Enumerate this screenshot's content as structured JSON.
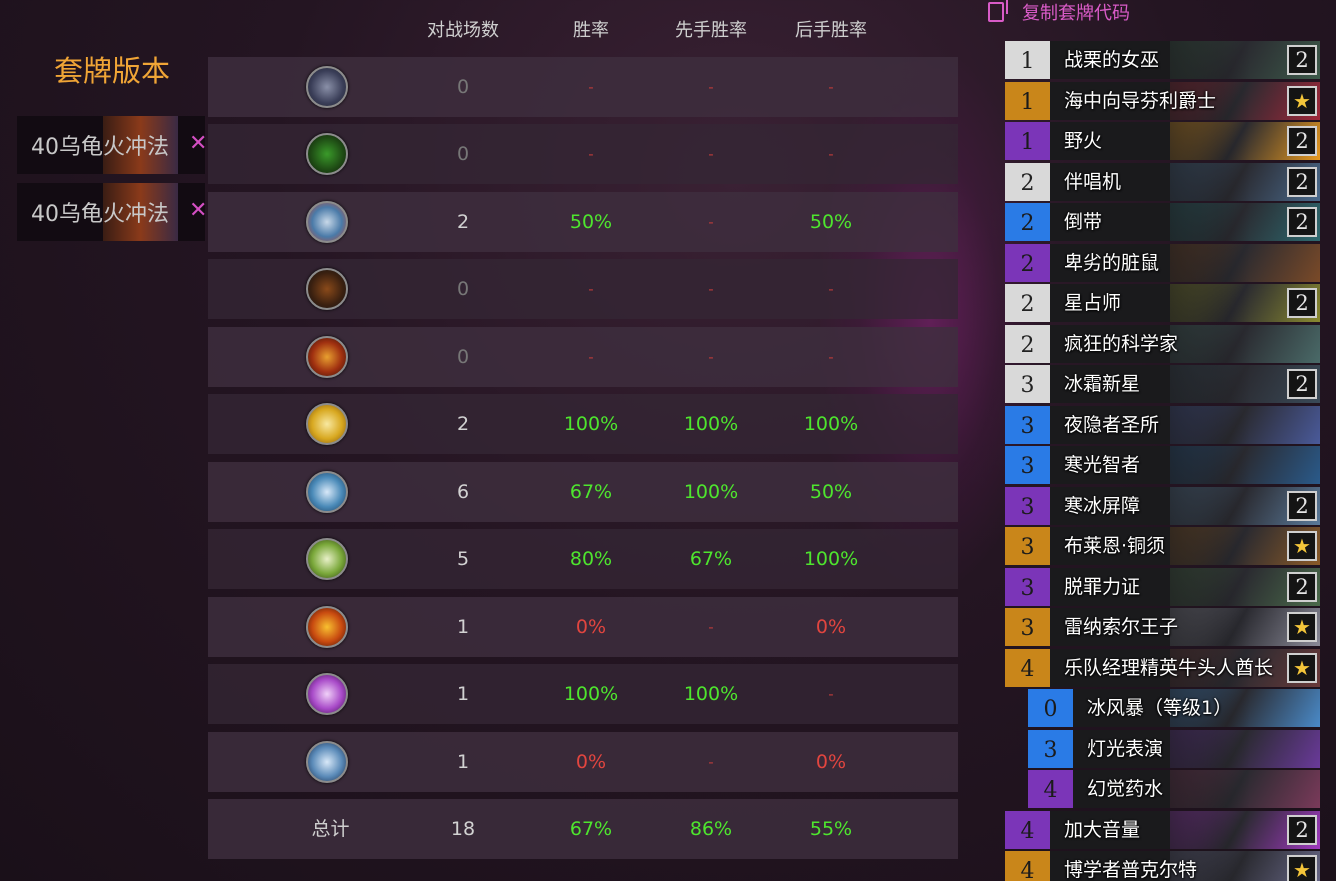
{
  "version_panel": {
    "title": "套牌版本",
    "versions": [
      {
        "name": "40乌龟火冲法",
        "remove_icon": "close-icon"
      },
      {
        "name": "40乌龟火冲法",
        "remove_icon": "close-icon"
      }
    ]
  },
  "stats": {
    "headers": {
      "games": "对战场数",
      "winrate": "胜率",
      "first": "先手胜率",
      "second": "后手胜率"
    },
    "rows": [
      {
        "class_icon": "demon-hunter-icon",
        "games": "0",
        "winrate": "-",
        "first": "-",
        "second": "-"
      },
      {
        "class_icon": "druid-icon",
        "games": "0",
        "winrate": "-",
        "first": "-",
        "second": "-"
      },
      {
        "class_icon": "death-knight-icon",
        "games": "2",
        "winrate": "50%",
        "first": "-",
        "second": "50%"
      },
      {
        "class_icon": "hunter-icon",
        "games": "0",
        "winrate": "-",
        "first": "-",
        "second": "-"
      },
      {
        "class_icon": "mage-icon",
        "games": "0",
        "winrate": "-",
        "first": "-",
        "second": "-"
      },
      {
        "class_icon": "paladin-icon",
        "games": "2",
        "winrate": "100%",
        "first": "100%",
        "second": "100%"
      },
      {
        "class_icon": "priest-icon",
        "games": "6",
        "winrate": "67%",
        "first": "100%",
        "second": "50%"
      },
      {
        "class_icon": "rogue-icon",
        "games": "5",
        "winrate": "80%",
        "first": "67%",
        "second": "100%"
      },
      {
        "class_icon": "shaman-icon",
        "games": "1",
        "winrate": "0%",
        "first": "-",
        "second": "0%"
      },
      {
        "class_icon": "warlock-icon",
        "games": "1",
        "winrate": "100%",
        "first": "100%",
        "second": "-"
      },
      {
        "class_icon": "warrior-icon",
        "games": "1",
        "winrate": "0%",
        "first": "-",
        "second": "0%"
      }
    ],
    "total": {
      "label": "总计",
      "games": "18",
      "winrate": "67%",
      "first": "86%",
      "second": "55%"
    }
  },
  "deck": {
    "copy_label": "复制套牌代码",
    "copy_icon": "copy-icon",
    "cards": [
      {
        "cost": "1",
        "name": "战栗的女巫",
        "count": "2",
        "rarity": "free",
        "art": "#3d5a4a"
      },
      {
        "cost": "1",
        "name": "海中向导芬利爵士",
        "count": "★",
        "rarity": "leg",
        "art": "#a0283a"
      },
      {
        "cost": "1",
        "name": "野火",
        "count": "2",
        "rarity": "epic",
        "art": "#e89a20"
      },
      {
        "cost": "2",
        "name": "伴唱机",
        "count": "2",
        "rarity": "free",
        "art": "#4a6a8c"
      },
      {
        "cost": "2",
        "name": "倒带",
        "count": "2",
        "rarity": "rare",
        "art": "#2e6a70"
      },
      {
        "cost": "2",
        "name": "卑劣的脏鼠",
        "count": "",
        "rarity": "epic",
        "art": "#7a4a28"
      },
      {
        "cost": "2",
        "name": "星占师",
        "count": "2",
        "rarity": "free",
        "art": "#8a8a30"
      },
      {
        "cost": "2",
        "name": "疯狂的科学家",
        "count": "",
        "rarity": "free",
        "art": "#4a6a68"
      },
      {
        "cost": "3",
        "name": "冰霜新星",
        "count": "2",
        "rarity": "free",
        "art": "#3a4a58"
      },
      {
        "cost": "3",
        "name": "夜隐者圣所",
        "count": "",
        "rarity": "rare",
        "art": "#4a5a9a"
      },
      {
        "cost": "3",
        "name": "寒光智者",
        "count": "",
        "rarity": "rare",
        "art": "#2a5a8a"
      },
      {
        "cost": "3",
        "name": "寒冰屏障",
        "count": "2",
        "rarity": "epic",
        "art": "#5a7a9a"
      },
      {
        "cost": "3",
        "name": "布莱恩·铜须",
        "count": "★",
        "rarity": "leg",
        "art": "#8a5a28"
      },
      {
        "cost": "3",
        "name": "脱罪力证",
        "count": "2",
        "rarity": "epic",
        "art": "#4a6a4a"
      },
      {
        "cost": "3",
        "name": "雷纳索尔王子",
        "count": "★",
        "rarity": "leg",
        "art": "#8a8a98"
      },
      {
        "cost": "4",
        "name": "乐队经理精英牛头人酋长",
        "count": "★",
        "rarity": "leg",
        "art": "#6a3a3a"
      },
      {
        "cost": "0",
        "name": "冰风暴（等级1）",
        "count": "",
        "rarity": "rare",
        "art": "#4a8ac8",
        "sub": true
      },
      {
        "cost": "3",
        "name": "灯光表演",
        "count": "",
        "rarity": "rare",
        "art": "#6a3a9a",
        "sub": true
      },
      {
        "cost": "4",
        "name": "幻觉药水",
        "count": "",
        "rarity": "epic",
        "art": "#7a3a5a",
        "sub": true
      },
      {
        "cost": "4",
        "name": "加大音量",
        "count": "2",
        "rarity": "epic",
        "art": "#a03ac0"
      },
      {
        "cost": "4",
        "name": "博学者普克尔特",
        "count": "★",
        "rarity": "leg",
        "art": "#6a6a8a"
      }
    ]
  },
  "colors": {
    "accent_orange": "#f0a536",
    "accent_pink": "#d95bc7",
    "win_green": "#4ee52e",
    "loss_red": "#e1453f"
  }
}
